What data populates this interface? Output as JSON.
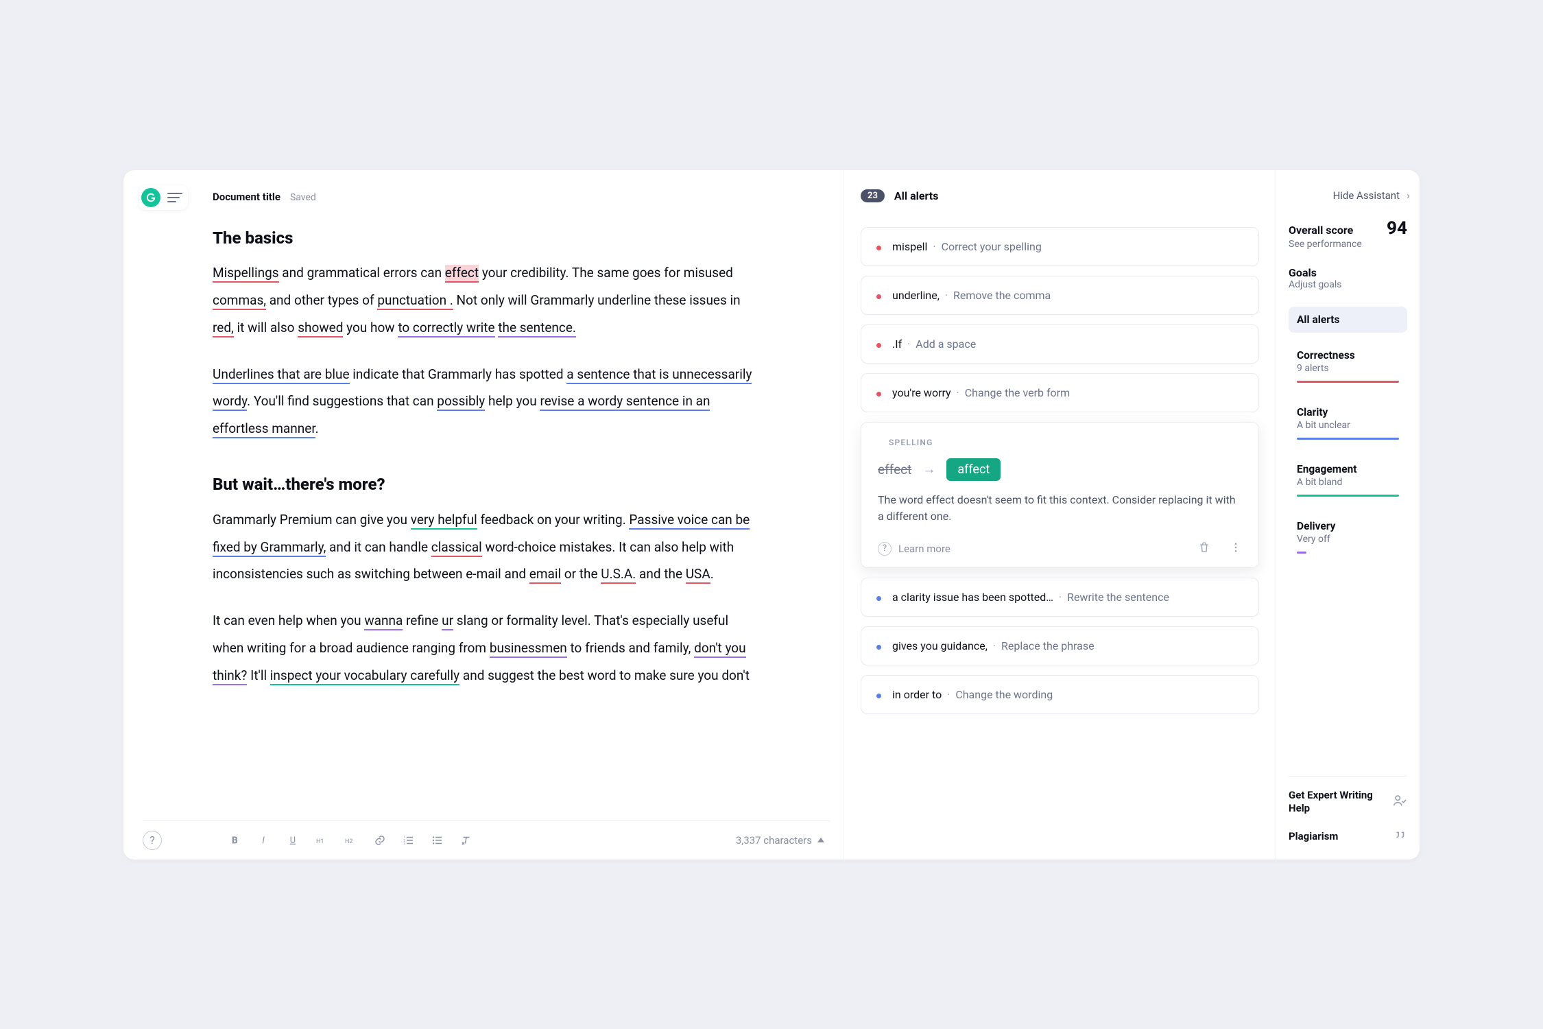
{
  "header": {
    "doc_title": "Document title",
    "saved_label": "Saved"
  },
  "editor": {
    "h_basics": "The basics",
    "p1": {
      "t1": "Mispellings",
      "t2": " and grammatical errors can ",
      "t3": "effect",
      "t4": " your credibility. The same goes for misused ",
      "t5": "commas,",
      "t6": " and other types of ",
      "t7": "punctuation .",
      "t8": " Not only will Grammarly underline these issues in ",
      "t9": "red,",
      "t10": " it will also ",
      "t11": "showed",
      "t12": " you how ",
      "t13": "to correctly write",
      "t14": " ",
      "t15": "the sentence.",
      "lead_space": " "
    },
    "p2": {
      "t1": "Underlines that are blue",
      "t2": " indicate that Grammarly has spotted ",
      "t3": "a sentence that is unnecessarily wordy",
      "t4": ". You'll find suggestions that can ",
      "t5": "possibly",
      "t6": " help you ",
      "t7": "revise a wordy sentence in an effortless manner",
      "t8": "."
    },
    "h_more": "But wait…there's more?",
    "p3": {
      "t1": "Grammarly Premium can give you ",
      "t2": "very helpful",
      "t3": " feedback on your writing. ",
      "t4": "Passive voice can be fixed by Grammarly,",
      "t5": " and it can handle ",
      "t6": "classical",
      "t7": " word-choice mistakes. It can also help with inconsistencies such as switching between e-mail and ",
      "t8": "email",
      "t9": " or the ",
      "t10": "U.S.A.",
      "t11": " and the ",
      "t12": "USA",
      "t13": "."
    },
    "p4": {
      "t1": "It can even help when you ",
      "t2": "wanna",
      "t3": " refine ",
      "t4": "ur",
      "t5": " slang or formality level. That's especially useful when writing for a broad audience ranging from ",
      "t6": "businessmen",
      "t7": " to friends and family, ",
      "t8": "don't you think?",
      "t9": " It'll ",
      "t10": "inspect your vocabulary carefully",
      "t11": " and suggest the best word to make sure you don't"
    }
  },
  "footer": {
    "char_count": "3,337 characters"
  },
  "alerts": {
    "count": "23",
    "heading": "All alerts",
    "items": [
      {
        "color": "red",
        "main": "mispell",
        "sub": "Correct your spelling"
      },
      {
        "color": "red",
        "main": "underline,",
        "sub": "Remove the comma"
      },
      {
        "color": "red",
        "main": ".If",
        "sub": "Add a space"
      },
      {
        "color": "red",
        "main": "you're worry",
        "sub": "Change the verb form"
      }
    ],
    "expanded": {
      "category": "SPELLING",
      "from": "effect",
      "to": "affect",
      "description": "The word effect doesn't seem to fit this context. Consider replacing it with a different one.",
      "learn_more": "Learn more"
    },
    "items_after": [
      {
        "color": "blue",
        "main": "a clarity issue has been spotted…",
        "sub": "Rewrite the sentence"
      },
      {
        "color": "blue",
        "main": "gives you guidance,",
        "sub": "Replace the phrase"
      },
      {
        "color": "blue",
        "main": "in order to",
        "sub": "Change the wording"
      }
    ]
  },
  "meta": {
    "hide_label": "Hide Assistant",
    "score_label": "Overall score",
    "score_value": "94",
    "score_sub": "See performance",
    "goals_label": "Goals",
    "goals_sub": "Adjust goals",
    "metrics": [
      {
        "head": "All alerts",
        "sub": "",
        "bar": "all",
        "active": true,
        "short": false
      },
      {
        "head": "Correctness",
        "sub": "9 alerts",
        "bar": "red",
        "active": false,
        "short": false
      },
      {
        "head": "Clarity",
        "sub": "A bit unclear",
        "bar": "blue",
        "active": false,
        "short": false
      },
      {
        "head": "Engagement",
        "sub": "A bit bland",
        "bar": "teal",
        "active": false,
        "short": false
      },
      {
        "head": "Delivery",
        "sub": "Very off",
        "bar": "violet",
        "active": false,
        "short": true
      }
    ],
    "footer": {
      "expert": "Get Expert Writing Help",
      "plagiarism": "Plagiarism"
    }
  }
}
